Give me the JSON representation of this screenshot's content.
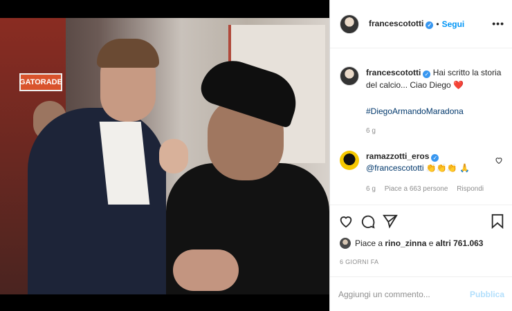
{
  "header": {
    "username": "francescototti",
    "verified": true,
    "dot": "•",
    "follow_label": "Segui",
    "more_icon": "•••"
  },
  "caption": {
    "username": "francescototti",
    "text": "Hai scritto la storia del calcio... Ciao Diego",
    "emoji": "❤️",
    "hashtag": "#DiegoArmandoMaradona",
    "time": "6 g"
  },
  "comment": {
    "username": "ramazzotti_eros",
    "verified": true,
    "mention": "@francescototti",
    "emoji": "👏👏👏 🙏",
    "time": "6 g",
    "likes": "Piace a 663 persone",
    "reply_label": "Rispondi"
  },
  "likes": {
    "prefix": "Piace a",
    "user": "rino_zinna",
    "connector": "e",
    "others": "altri 761.063"
  },
  "post_date": "6 GIORNI FA",
  "add_comment": {
    "placeholder": "Aggiungi un commento...",
    "publish_label": "Pubblica"
  },
  "photo": {
    "sign_text": "GATORADE"
  },
  "colors": {
    "link_blue": "#0095f6",
    "muted": "#8e8e8e",
    "verified_blue": "#3897f0",
    "publish_disabled": "#b2dffc"
  }
}
